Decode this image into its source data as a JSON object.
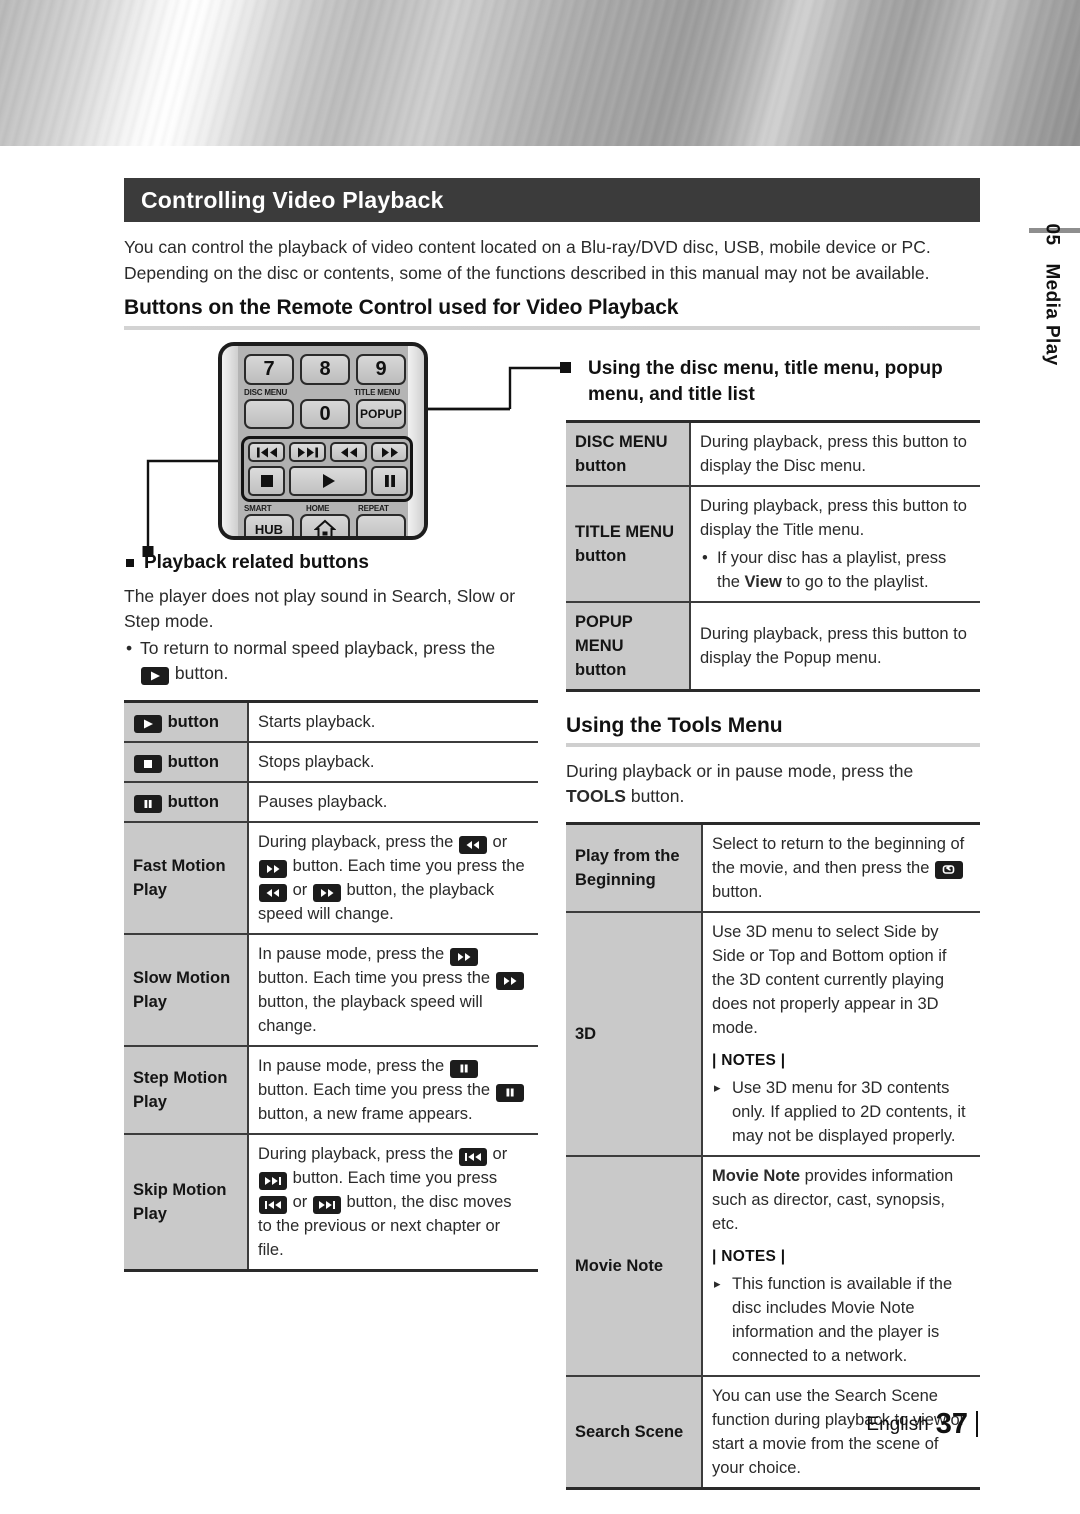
{
  "chapter_tab": {
    "number": "05",
    "label": "Media Play"
  },
  "section": {
    "title": "Controlling Video Playback",
    "intro": "You can control the playback of video content located on a Blu-ray/DVD disc, USB, mobile device or PC. Depending on the disc or contents, some of the functions described in this manual may not be available.",
    "subheading": "Buttons on the Remote Control used for Video Playback"
  },
  "remote": {
    "keys": {
      "seven": "7",
      "eight": "8",
      "nine": "9",
      "zero": "0",
      "popup": "POPUP",
      "hub": "HUB"
    },
    "labels": {
      "disc_menu": "DISC MENU",
      "title_menu": "TITLE MENU",
      "smart": "SMART",
      "home": "HOME",
      "repeat": "REPEAT"
    },
    "icons": {
      "prev": "skip-backward-icon",
      "next": "skip-forward-icon",
      "rewind": "rewind-icon",
      "forward": "fast-forward-icon",
      "stop": "stop-icon",
      "play": "play-icon",
      "pause": "pause-icon",
      "home": "home-icon"
    }
  },
  "left": {
    "bullet_heading": "Playback related buttons",
    "paragraph": "The player does not play sound in Search, Slow or Step mode.",
    "dot_note_pre": "To return to normal speed playback, press the",
    "dot_note_post": "button.",
    "table": [
      {
        "key_kind": "play",
        "key_suffix": "button",
        "lines": [
          "Starts playback."
        ]
      },
      {
        "key_kind": "stop",
        "key_suffix": "button",
        "lines": [
          "Stops playback."
        ]
      },
      {
        "key_kind": "pause",
        "key_suffix": "button",
        "lines": [
          "Pauses playback."
        ]
      },
      {
        "key_text": "Fast Motion Play",
        "lines": [
          "During playback, press the [rew] or [ff] button.",
          "Each time you press the [rew] or [ff] button, the playback speed will change."
        ]
      },
      {
        "key_text": "Slow Motion Play",
        "lines": [
          "In pause mode, press the [ff] button.",
          "Each time you press the [ff] button, the playback speed will change."
        ]
      },
      {
        "key_text": "Step Motion Play",
        "lines": [
          "In pause mode, press the [pause] button.",
          "Each time you press the [pause] button, a new frame appears."
        ]
      },
      {
        "key_text": "Skip Motion Play",
        "lines": [
          "During playback, press the [prev] or [next] button.",
          "Each time you press [prev] or [next] button, the disc moves to the previous or next chapter or file."
        ]
      }
    ],
    "row_text": {
      "fast_l1a": "During playback, press the",
      "fast_l1b": "or",
      "fast_l1c": "button.",
      "fast_l2a": "Each time you press the",
      "fast_l2b": "or",
      "fast_l2c": "button, the playback speed will change.",
      "slow_l1a": "In pause mode, press the",
      "slow_l1b": "button.",
      "slow_l2a": "Each time you press the",
      "slow_l2b": "button, the playback speed will change.",
      "step_l1a": "In pause mode, press the",
      "step_l1b": "button.",
      "step_l2a": "Each time you press the",
      "step_l2b": "button, a new frame appears.",
      "skip_l1a": "During playback, press the",
      "skip_l1b": "or",
      "skip_l1c": "button.",
      "skip_l2a": "Each time you press",
      "skip_l2b": "or",
      "skip_l2c": "button, the disc moves to the previous or next chapter or file."
    },
    "keys_labels": {
      "play_button": "button",
      "stop_button": "button",
      "pause_button": "button",
      "fast_motion": "Fast Motion Play",
      "slow_motion": "Slow Motion Play",
      "step_motion": "Step Motion Play",
      "skip_motion": "Skip Motion Play"
    }
  },
  "right": {
    "bullet_heading": "Using the disc menu, title menu, popup menu, and title list",
    "menu_table": [
      {
        "key": "DISC MENU button",
        "body": "During playback, press this button to display the Disc menu."
      },
      {
        "key": "TITLE MENU button",
        "body": "During playback, press this button to display the Title menu."
      },
      {
        "key": "POPUP MENU button",
        "body": "During playback, press this button to display the Popup menu."
      }
    ],
    "keys": {
      "disc_menu_l1": "DISC MENU",
      "disc_menu_l2": "button",
      "title_menu_l1": "TITLE MENU",
      "title_menu_l2": "button",
      "popup_menu_l1": "POPUP MENU",
      "popup_menu_l2": "button"
    },
    "disc_menu_body": "During playback, press this button to display the Disc menu.",
    "title_menu_body": "During playback, press this button to display the Title menu.",
    "title_menu_dot_a": "If your disc has a playlist, press the",
    "title_menu_dot_bold": "View",
    "title_menu_dot_b": "to go to the playlist.",
    "popup_menu_body": "During playback, press this button to display the Popup menu.",
    "tools_heading": "Using the Tools Menu",
    "tools_intro_a": "During playback or in pause mode, press the",
    "tools_intro_bold": "TOOLS",
    "tools_intro_b": "button.",
    "tools_table": {
      "play_from_beginning_key_l1": "Play from the",
      "play_from_beginning_key_l2": "Beginning",
      "play_from_beginning_body_a": "Select to return to the beginning of the movie, and then press the",
      "play_from_beginning_body_b": "button.",
      "three_d_key": "3D",
      "three_d_body": "Use 3D menu to select Side by Side or Top and Bottom option if the 3D content currently playing does not properly appear in 3D mode.",
      "three_d_notes_label": "| NOTES |",
      "three_d_note": "Use 3D menu for 3D contents only. If applied to 2D contents, it may not be displayed properly.",
      "movie_note_key": "Movie Note",
      "movie_note_bold": "Movie Note",
      "movie_note_body": "provides information such as director, cast, synopsis, etc.",
      "movie_note_notes_label": "| NOTES |",
      "movie_note_note": "This function is available if the disc includes Movie Note information and the player is connected to a network.",
      "search_scene_key": "Search Scene",
      "search_scene_body": "You can use the Search Scene function during playback to view or start a movie from the scene of your choice."
    }
  },
  "footer": {
    "language": "English",
    "page": "37"
  },
  "colors": {
    "title_bar_bg": "#3b3b3b",
    "table_key_bg": "#c9c9c9",
    "rule": "#2a2a2a",
    "banner_metal": "#b0b0b0"
  }
}
